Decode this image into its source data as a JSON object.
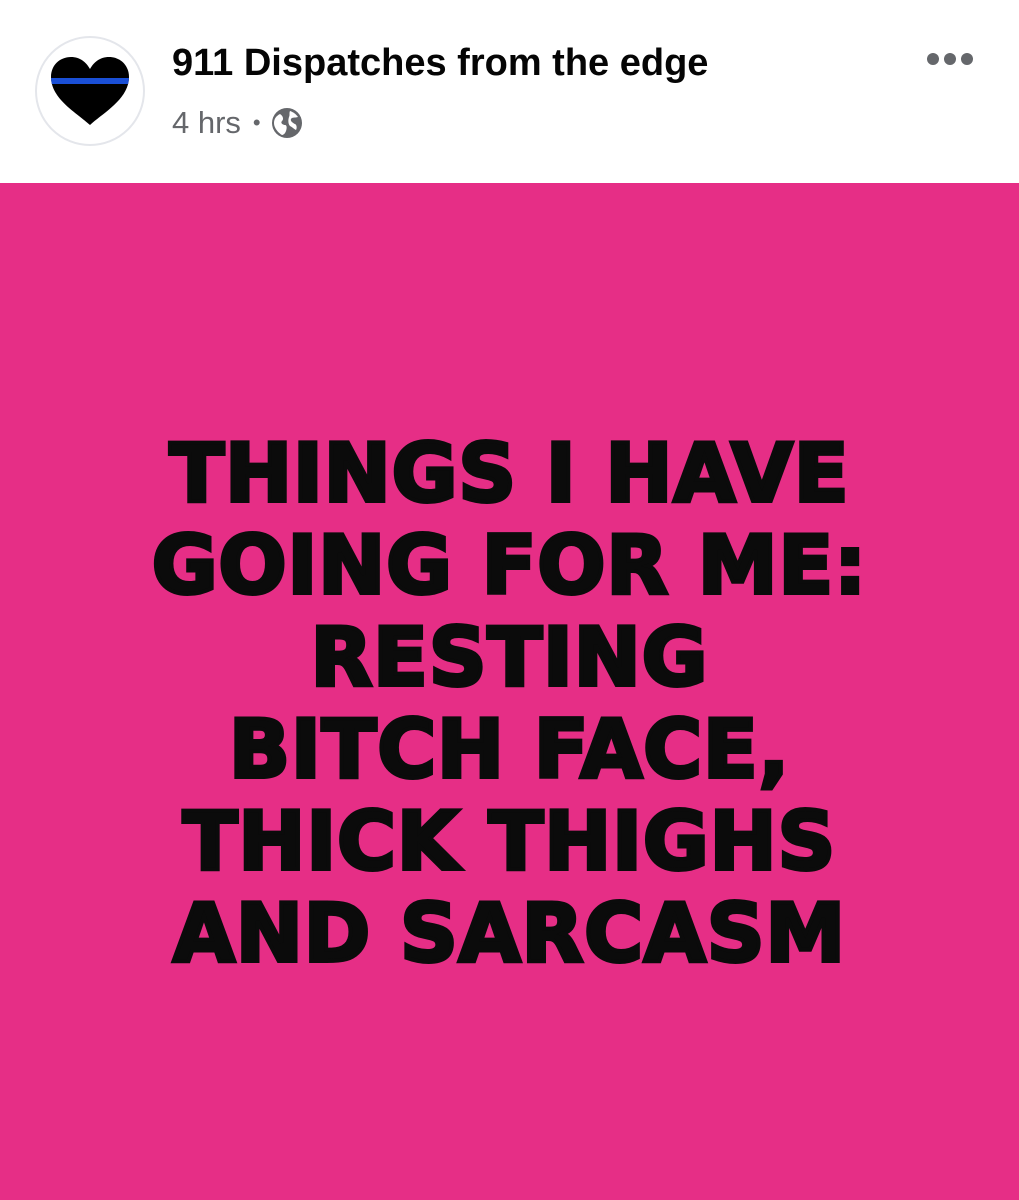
{
  "post": {
    "page_name": "911 Dispatches from the edge",
    "time": "4 hrs",
    "separator": "•",
    "privacy_icon": "globe-icon",
    "more_icon": "more-options-icon",
    "avatar_icon": "thin-blue-line-heart-icon"
  },
  "image": {
    "background_color": "#e62e86",
    "lines": [
      "THINGS I HAVE",
      "GOING FOR ME:",
      "RESTING",
      "BITCH FACE,",
      "THICK THIGHS",
      "AND SARCASM"
    ]
  },
  "colors": {
    "accent_blue": "#1a4fd6",
    "heart": "#000000",
    "meta_text": "#65676b"
  }
}
